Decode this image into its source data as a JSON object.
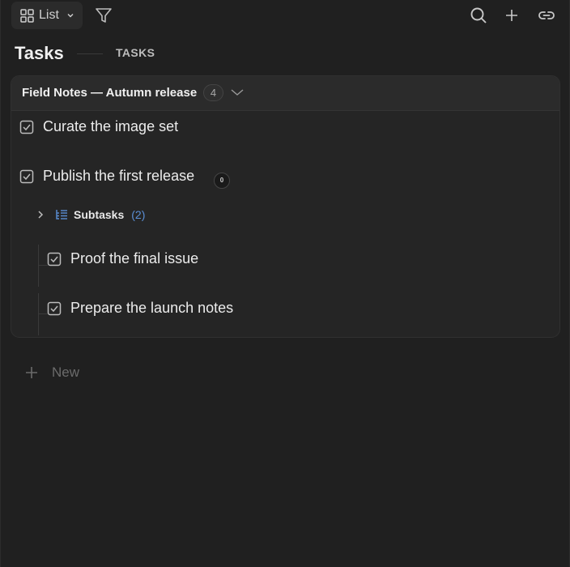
{
  "toolbar": {
    "view_label": "List",
    "icons": [
      "grid-icon",
      "chevron-down-icon",
      "filter-icon",
      "search-icon",
      "plus-icon",
      "link-icon"
    ]
  },
  "page": {
    "title": "Tasks",
    "tab_label": "TASKS"
  },
  "group": {
    "title": "Field Notes — Autumn release",
    "count": "4"
  },
  "tasks": [
    {
      "label": "Curate the image set"
    },
    {
      "label": "Publish the first release",
      "badge": "0"
    }
  ],
  "subtasks": {
    "label": "Subtasks",
    "count": "(2)",
    "items": [
      {
        "label": "Proof the final issue"
      },
      {
        "label": "Prepare the launch notes"
      }
    ]
  },
  "new_item": {
    "label": "New"
  },
  "colors": {
    "background": "#202020",
    "card": "#252525",
    "accent": "#5b8fd6"
  }
}
